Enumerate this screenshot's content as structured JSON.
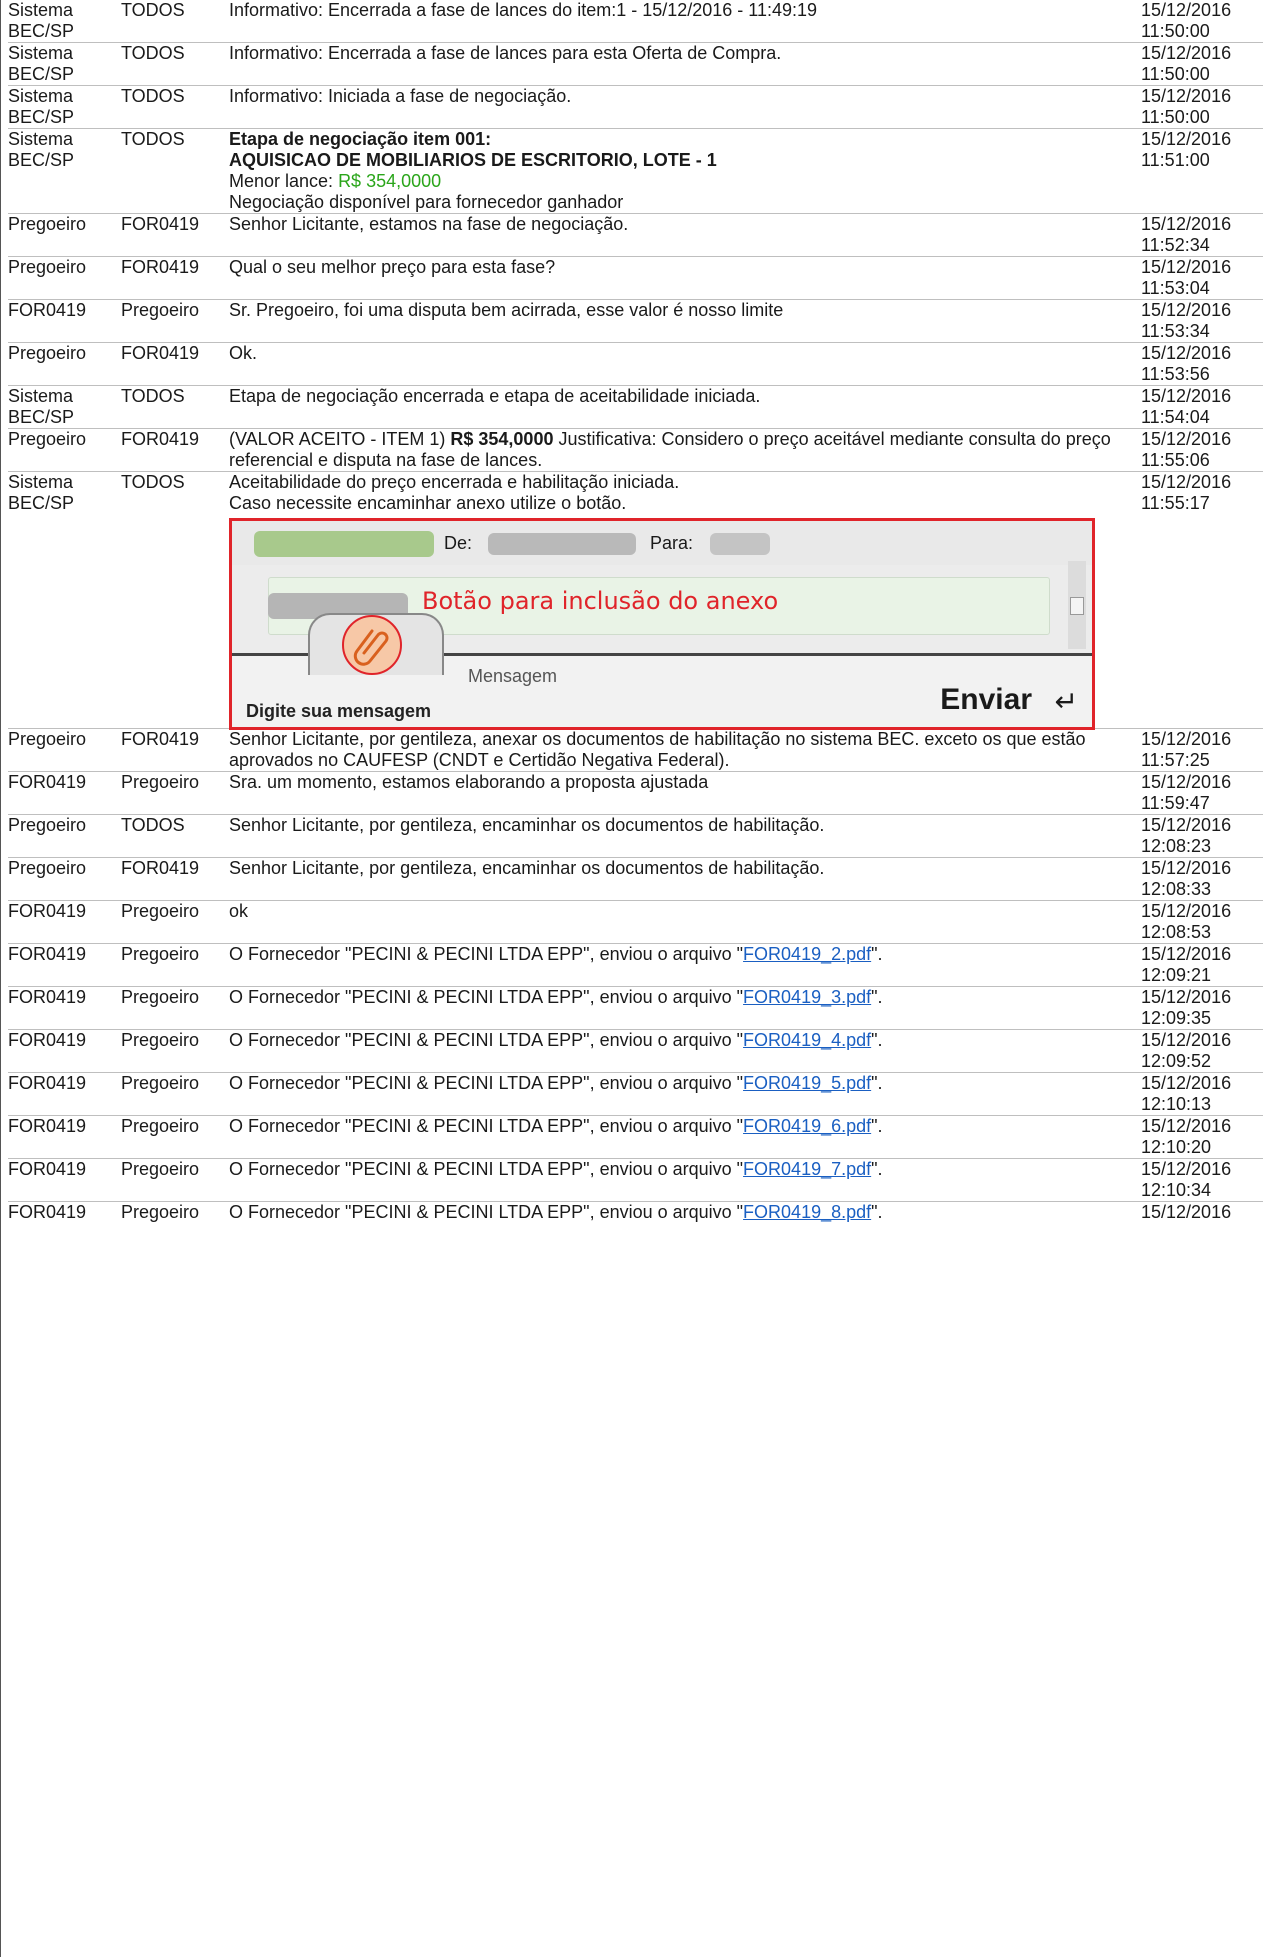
{
  "messages": [
    {
      "from": "Sistema BEC/SP",
      "to": "TODOS",
      "text": "Informativo: Encerrada a fase de lances do item:1 - 15/12/2016 - 11:49:19",
      "date": "15/12/2016",
      "time": "11:50:00"
    },
    {
      "from": "Sistema BEC/SP",
      "to": "TODOS",
      "text": "Informativo: Encerrada a fase de lances para esta Oferta de Compra.",
      "date": "15/12/2016",
      "time": "11:50:00"
    },
    {
      "from": "Sistema BEC/SP",
      "to": "TODOS",
      "text": "Informativo: Iniciada a fase de negociação.",
      "date": "15/12/2016",
      "time": "11:50:00"
    },
    {
      "from": "Sistema BEC/SP",
      "to": "TODOS",
      "date": "15/12/2016",
      "time": "11:51:00",
      "title1": "Etapa de negociação item 001:",
      "title2": "AQUISICAO DE MOBILIARIOS DE ESCRITORIO, LOTE - 1",
      "lance_label": "Menor lance: ",
      "lance_value": "R$ 354,0000",
      "note": "Negociação disponível para fornecedor ganhador"
    },
    {
      "from": "Pregoeiro",
      "to": "FOR0419",
      "text": "Senhor Licitante, estamos na fase de negociação.",
      "date": "15/12/2016",
      "time": "11:52:34"
    },
    {
      "from": "Pregoeiro",
      "to": "FOR0419",
      "text": "Qual o seu melhor preço para esta fase?",
      "date": "15/12/2016",
      "time": "11:53:04"
    },
    {
      "from": "FOR0419",
      "to": "Pregoeiro",
      "text": "Sr. Pregoeiro, foi uma disputa bem acirrada, esse valor é nosso limite",
      "date": "15/12/2016",
      "time": "11:53:34"
    },
    {
      "from": "Pregoeiro",
      "to": "FOR0419",
      "text": "Ok.",
      "date": "15/12/2016",
      "time": "11:53:56"
    },
    {
      "from": "Sistema BEC/SP",
      "to": "TODOS",
      "text": "Etapa de negociação encerrada e etapa de aceitabilidade iniciada.",
      "date": "15/12/2016",
      "time": "11:54:04"
    },
    {
      "from": "Pregoeiro",
      "to": "FOR0419",
      "date": "15/12/2016",
      "time": "11:55:06",
      "pre": "(VALOR ACEITO - ITEM 1) ",
      "bold": "R$ 354,0000",
      "post": " Justificativa: Considero o preço aceitável mediante consulta do preço referencial e disputa na fase de lances."
    },
    {
      "from": "Sistema BEC/SP",
      "to": "TODOS",
      "date": "15/12/2016",
      "time": "11:55:17",
      "line1": "Aceitabilidade do preço encerrada e habilitação iniciada.",
      "line2": "Caso necessite encaminhar anexo utilize o botão.",
      "image": {
        "de": "De:",
        "para": "Para:",
        "annotation": "Botão para inclusão do anexo",
        "tab_label": "Digite sua mensagem",
        "message_label": "Mensagem",
        "send": "Enviar",
        "clip_icon": "paperclip-icon",
        "enter_icon": "enter-key-icon"
      }
    },
    {
      "from": "Pregoeiro",
      "to": "FOR0419",
      "text": "Senhor Licitante, por gentileza, anexar os documentos de habilitação no sistema BEC. exceto os que estão aprovados no CAUFESP (CNDT e Certidão Negativa Federal).",
      "date": "15/12/2016",
      "time": "11:57:25"
    },
    {
      "from": "FOR0419",
      "to": "Pregoeiro",
      "text": "Sra. um momento, estamos elaborando a proposta ajustada",
      "date": "15/12/2016",
      "time": "11:59:47"
    },
    {
      "from": "Pregoeiro",
      "to": "TODOS",
      "text": "Senhor Licitante, por gentileza, encaminhar os documentos de habilitação.",
      "date": "15/12/2016",
      "time": "12:08:23"
    },
    {
      "from": "Pregoeiro",
      "to": "FOR0419",
      "text": "Senhor Licitante, por gentileza, encaminhar os documentos de habilitação.",
      "date": "15/12/2016",
      "time": "12:08:33"
    },
    {
      "from": "FOR0419",
      "to": "Pregoeiro",
      "text": "ok",
      "date": "15/12/2016",
      "time": "12:08:53"
    },
    {
      "from": "FOR0419",
      "to": "Pregoeiro",
      "pre": "O Fornecedor \"PECINI & PECINI LTDA EPP\", enviou o arquivo \"",
      "file": "FOR0419_2.pdf",
      "post": "\".",
      "date": "15/12/2016",
      "time": "12:09:21"
    },
    {
      "from": "FOR0419",
      "to": "Pregoeiro",
      "pre": "O Fornecedor \"PECINI & PECINI LTDA EPP\", enviou o arquivo \"",
      "file": "FOR0419_3.pdf",
      "post": "\".",
      "date": "15/12/2016",
      "time": "12:09:35"
    },
    {
      "from": "FOR0419",
      "to": "Pregoeiro",
      "pre": "O Fornecedor \"PECINI & PECINI LTDA EPP\", enviou o arquivo \"",
      "file": "FOR0419_4.pdf",
      "post": "\".",
      "date": "15/12/2016",
      "time": "12:09:52"
    },
    {
      "from": "FOR0419",
      "to": "Pregoeiro",
      "pre": "O Fornecedor \"PECINI & PECINI LTDA EPP\", enviou o arquivo \"",
      "file": "FOR0419_5.pdf",
      "post": "\".",
      "date": "15/12/2016",
      "time": "12:10:13"
    },
    {
      "from": "FOR0419",
      "to": "Pregoeiro",
      "pre": "O Fornecedor \"PECINI & PECINI LTDA EPP\", enviou o arquivo \"",
      "file": "FOR0419_6.pdf",
      "post": "\".",
      "date": "15/12/2016",
      "time": "12:10:20"
    },
    {
      "from": "FOR0419",
      "to": "Pregoeiro",
      "pre": "O Fornecedor \"PECINI & PECINI LTDA EPP\", enviou o arquivo \"",
      "file": "FOR0419_7.pdf",
      "post": "\".",
      "date": "15/12/2016",
      "time": "12:10:34"
    },
    {
      "from": "FOR0419",
      "to": "Pregoeiro",
      "pre": "O Fornecedor \"PECINI & PECINI LTDA EPP\", enviou o arquivo \"",
      "file": "FOR0419_8.pdf",
      "post": "\".",
      "date": "15/12/2016",
      "time": ""
    }
  ]
}
